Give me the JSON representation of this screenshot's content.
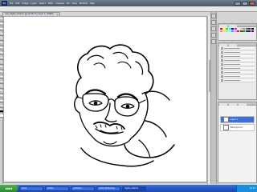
{
  "app": {
    "logo": "Ps",
    "menu": [
      "File",
      "Edit",
      "Image",
      "Layer",
      "Select",
      "Filter",
      "Analysis",
      "3D",
      "View",
      "Window",
      "Help"
    ],
    "window_buttons": [
      "–",
      "□",
      "×"
    ]
  },
  "document": {
    "tab_title": "new_digital_artwork.jpg @ 66.7% (Layer 1, RGB/8)",
    "tab_close": "×"
  },
  "layers_panel": {
    "selected_layer": "Layer 1",
    "background_layer": "Background"
  },
  "colors": {
    "accent": "#3d6fd6",
    "taskbar": "#2453c4",
    "start": "#2f8a2f",
    "swatches": [
      "#ff0000",
      "#ffff00",
      "#00ff00",
      "#00ffff",
      "#0000ff",
      "#ff00ff",
      "#ffffff",
      "#cccccc",
      "#999999",
      "#666666",
      "#333333",
      "#000000",
      "#ff8080",
      "#ffcc80",
      "#80ff80",
      "#80ffff",
      "#8080ff",
      "#ff80ff",
      "#c04000",
      "#804000",
      "#408000",
      "#004080",
      "#400080",
      "#800040"
    ]
  },
  "taskbar": {
    "start": "start",
    "buttons": [
      "Inbox",
      "Firefox",
      "Untitled-1",
      "Adobe Photoshop",
      "digital_artwork"
    ],
    "active_index": 4,
    "clock": "10:24"
  }
}
